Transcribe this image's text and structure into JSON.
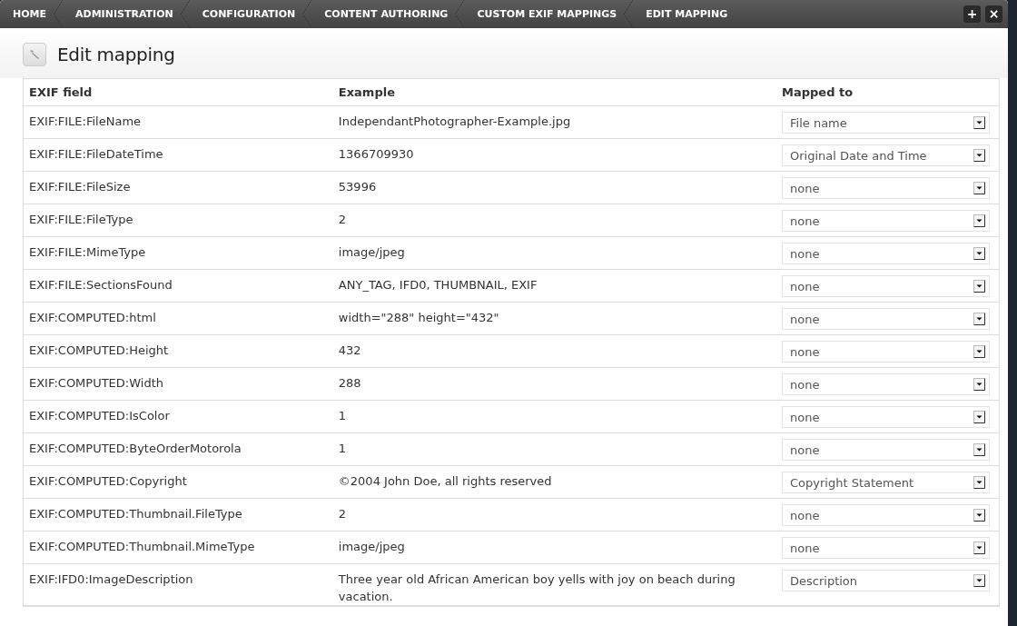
{
  "breadcrumb": [
    "HOME",
    "ADMINISTRATION",
    "CONFIGURATION",
    "CONTENT AUTHORING",
    "CUSTOM EXIF MAPPINGS",
    "EDIT MAPPING"
  ],
  "toolbar_buttons": [
    "+",
    "×"
  ],
  "page_title": "Edit mapping",
  "table": {
    "columns": [
      "EXIF field",
      "Example",
      "Mapped to"
    ],
    "rows": [
      {
        "field": "EXIF:FILE:FileName",
        "example": "IndependantPhotographer-Example.jpg",
        "mapped_to": "File name"
      },
      {
        "field": "EXIF:FILE:FileDateTime",
        "example": "1366709930",
        "mapped_to": "Original Date and Time"
      },
      {
        "field": "EXIF:FILE:FileSize",
        "example": "53996",
        "mapped_to": "none"
      },
      {
        "field": "EXIF:FILE:FileType",
        "example": "2",
        "mapped_to": "none"
      },
      {
        "field": "EXIF:FILE:MimeType",
        "example": "image/jpeg",
        "mapped_to": "none"
      },
      {
        "field": "EXIF:FILE:SectionsFound",
        "example": "ANY_TAG, IFD0, THUMBNAIL, EXIF",
        "mapped_to": "none"
      },
      {
        "field": "EXIF:COMPUTED:html",
        "example": "width=\"288\" height=\"432\"",
        "mapped_to": "none"
      },
      {
        "field": "EXIF:COMPUTED:Height",
        "example": "432",
        "mapped_to": "none"
      },
      {
        "field": "EXIF:COMPUTED:Width",
        "example": "288",
        "mapped_to": "none"
      },
      {
        "field": "EXIF:COMPUTED:IsColor",
        "example": "1",
        "mapped_to": "none"
      },
      {
        "field": "EXIF:COMPUTED:ByteOrderMotorola",
        "example": "1",
        "mapped_to": "none"
      },
      {
        "field": "EXIF:COMPUTED:Copyright",
        "example": "©2004 John Doe, all rights reserved",
        "mapped_to": "Copyright Statement"
      },
      {
        "field": "EXIF:COMPUTED:Thumbnail.FileType",
        "example": "2",
        "mapped_to": "none"
      },
      {
        "field": "EXIF:COMPUTED:Thumbnail.MimeType",
        "example": "image/jpeg",
        "mapped_to": "none"
      },
      {
        "field": "EXIF:IFD0:ImageDescription",
        "example": "Three year old African American boy yells with joy on beach during vacation.",
        "mapped_to": "Description"
      }
    ]
  }
}
